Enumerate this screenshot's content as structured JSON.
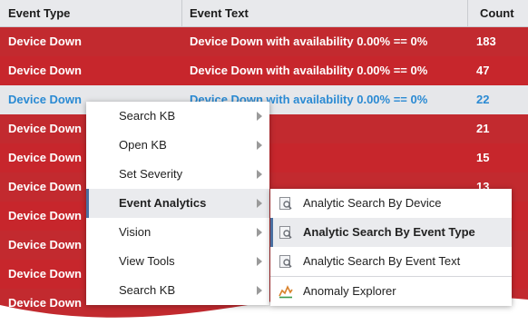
{
  "table": {
    "headers": [
      "Event Type",
      "Event Text",
      "Count"
    ],
    "rows": [
      {
        "type": "Device Down",
        "text": "Device Down with availability 0.00% == 0%",
        "count": "183"
      },
      {
        "type": "Device Down",
        "text": "Device Down with availability 0.00% == 0%",
        "count": "47"
      },
      {
        "type": "Device Down",
        "text": "Device Down with availability 0.00% == 0%",
        "count": "22"
      },
      {
        "type": "Device Down",
        "text": "",
        "count": "21"
      },
      {
        "type": "Device Down",
        "text": "",
        "count": "15"
      },
      {
        "type": "Device Down",
        "text": "",
        "count": "13"
      },
      {
        "type": "Device Down",
        "text": "",
        "count": ""
      },
      {
        "type": "Device Down",
        "text": "",
        "count": ""
      },
      {
        "type": "Device Down",
        "text": "",
        "count": ""
      },
      {
        "type": "Device Down",
        "text": "",
        "count": ""
      }
    ],
    "selected_row": 2
  },
  "context_menu": {
    "items": [
      "Search KB",
      "Open KB",
      "Set Severity",
      "Event Analytics",
      "Vision",
      "View Tools",
      "Search KB"
    ],
    "active": "Event Analytics"
  },
  "submenu": {
    "items": [
      "Analytic Search By Device",
      "Analytic Search By Event Type",
      "Analytic Search By Event Text",
      "Anomaly Explorer"
    ],
    "active": "Analytic Search By Event Type",
    "icons": [
      "search-document-icon",
      "search-document-icon",
      "search-document-icon",
      "anomaly-chart-icon"
    ]
  },
  "colors": {
    "row_red": "#c22a2f",
    "selected_text": "#2a8ad3",
    "header_bg": "#e8e9ec"
  }
}
